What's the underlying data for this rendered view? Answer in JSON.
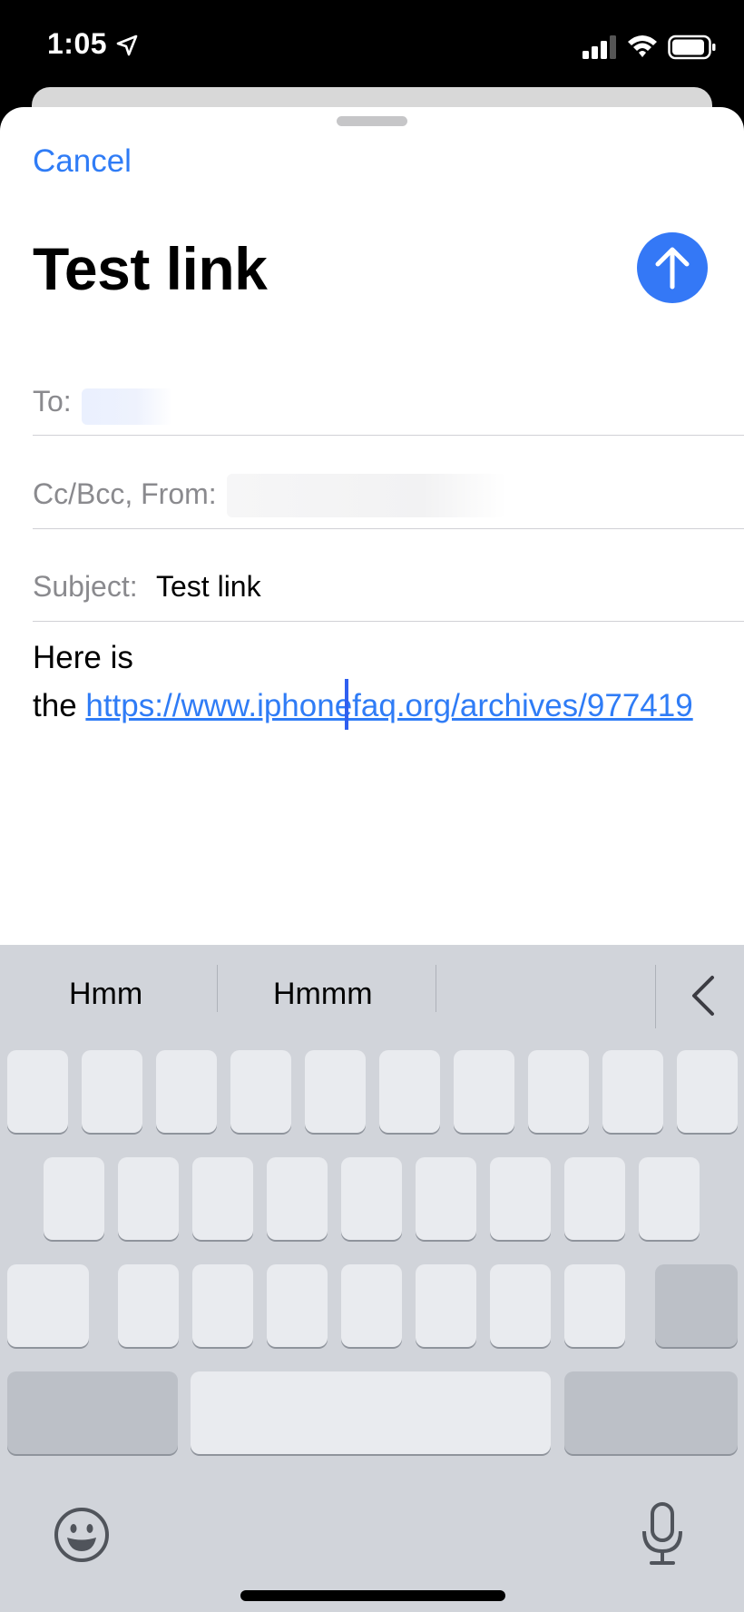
{
  "status_bar": {
    "time": "1:05"
  },
  "compose": {
    "cancel_label": "Cancel",
    "title": "Test link",
    "to_label": "To:",
    "ccbcc_label": "Cc/Bcc, From:",
    "subject_label": "Subject:",
    "subject_value": "Test link",
    "body_line1": "Here is",
    "body_prefix": "the",
    "body_link": "https://www.iphonefaq.org/archives/977419"
  },
  "keyboard": {
    "suggestions": [
      "Hmm",
      "Hmmm"
    ]
  },
  "colors": {
    "accent": "#3478f6",
    "link": "#2f7cf6",
    "keyboard_bg": "#d1d4da"
  }
}
